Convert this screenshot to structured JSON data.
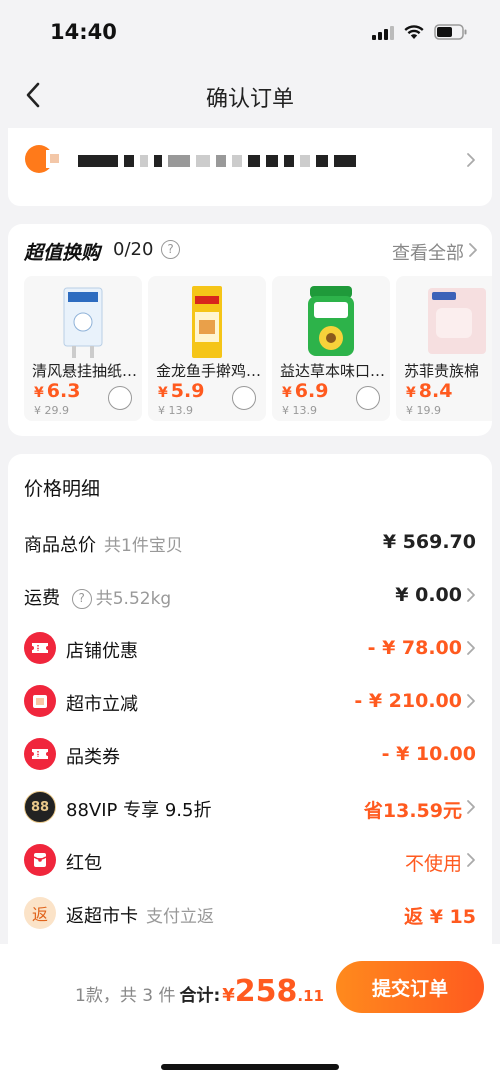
{
  "status_bar": {
    "time": "14:40"
  },
  "nav": {
    "title": "确认订单"
  },
  "exchange": {
    "title": "超值换购",
    "count": "0/20",
    "help_glyph": "?",
    "view_all": "查看全部",
    "products": [
      {
        "name": "清风悬挂抽纸…",
        "yen": "¥",
        "price": "6.3",
        "original": "¥ 29.9"
      },
      {
        "name": "金龙鱼手擀鸡…",
        "yen": "¥",
        "price": "5.9",
        "original": "¥ 13.9"
      },
      {
        "name": "益达草本味口…",
        "yen": "¥",
        "price": "6.9",
        "original": "¥ 13.9"
      },
      {
        "name": "苏菲贵族棉",
        "yen": "¥",
        "price": "8.4",
        "original": "¥ 19.9"
      }
    ]
  },
  "price_detail": {
    "title": "价格明细",
    "rows": {
      "total": {
        "label": "商品总价",
        "sub": "共1件宝贝",
        "value": "¥ 569.70"
      },
      "shipping": {
        "label": "运费",
        "help_glyph": "?",
        "sub": "共5.52kg",
        "value": "¥ 0.00"
      },
      "store": {
        "label": "店铺优惠",
        "value": "- ¥ 78.00"
      },
      "market": {
        "label": "超市立减",
        "value": "- ¥ 210.00"
      },
      "category": {
        "label": "品类券",
        "value": "- ¥ 10.00"
      },
      "vip": {
        "label": "88VIP 专享 9.5折",
        "icon_text": "88",
        "value": "省13.59元"
      },
      "redpacket": {
        "label": "红包",
        "value": "不使用"
      },
      "rebate": {
        "label": "返超市卡",
        "icon_text": "返",
        "sub": "支付立返",
        "value": "返 ¥ 15"
      }
    }
  },
  "bottom": {
    "count_text": "1款，共 3 件",
    "total_label": "合计:",
    "yen": "¥",
    "total_int": "258",
    "total_dec": ".11",
    "submit": "提交订单"
  },
  "colors": {
    "accent": "#ff5a1f",
    "red_icon": "#f0263c",
    "vip_black": "#222222",
    "rebate_bg": "#fbe3c8"
  }
}
